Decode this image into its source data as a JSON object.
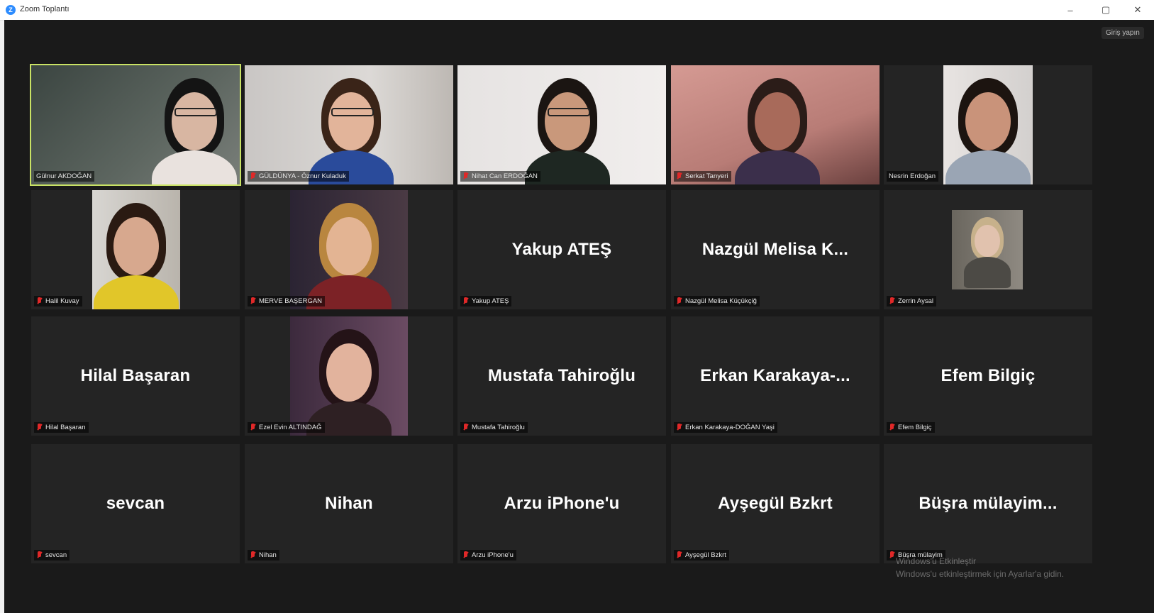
{
  "window": {
    "title": "Zoom Toplantı",
    "icon": "zoom-logo-icon",
    "minimize": "–",
    "maximize": "▢",
    "close": "✕"
  },
  "header": {
    "signin_label": "Giriş yapın"
  },
  "colors": {
    "active_speaker": "#c9e264",
    "muted_mic": "#e02828",
    "tile_bg": "#242424"
  },
  "participants": [
    {
      "label": "Gülnur AKDOĞAN",
      "display": "",
      "video": true,
      "active": true,
      "muted": false
    },
    {
      "label": "GÜLDÜNYA - Öznur Kuladuk",
      "display": "",
      "video": true,
      "muted": true
    },
    {
      "label": "Nihat Can ERDOĞAN",
      "display": "",
      "video": true,
      "muted": true
    },
    {
      "label": "Serkat Tanyeri",
      "display": "",
      "video": true,
      "muted": true
    },
    {
      "label": "Nesrin Erdoğan",
      "display": "",
      "video": true,
      "muted": false
    },
    {
      "label": "Halil Kuvay",
      "display": "",
      "video": true,
      "muted": true
    },
    {
      "label": "MERVE BAŞERGAN",
      "display": "",
      "video": true,
      "muted": true
    },
    {
      "label": "Yakup ATEŞ",
      "display": "Yakup ATEŞ",
      "video": false,
      "muted": true
    },
    {
      "label": "Nazgül Melisa Küçükçiğ",
      "display": "Nazgül  Melisa  K...",
      "video": false,
      "muted": true
    },
    {
      "label": "Zerrin Aysal",
      "display": "",
      "video": true,
      "muted": true
    },
    {
      "label": "Hilal Başaran",
      "display": "Hilal Başaran",
      "video": false,
      "muted": true
    },
    {
      "label": "Ezel Evin ALTINDAĞ",
      "display": "",
      "video": true,
      "muted": true
    },
    {
      "label": "Mustafa Tahiroğlu",
      "display": "Mustafa Tahiroğlu",
      "video": false,
      "muted": true
    },
    {
      "label": "Erkan Karakaya-DOĞAN Yaşi",
      "display": "Erkan  Karakaya-...",
      "video": false,
      "muted": true
    },
    {
      "label": "Efem Bilgiç",
      "display": "Efem Bilgiç",
      "video": false,
      "muted": true
    },
    {
      "label": "sevcan",
      "display": "sevcan",
      "video": false,
      "muted": true
    },
    {
      "label": "Nihan",
      "display": "Nihan",
      "video": false,
      "muted": true
    },
    {
      "label": "Arzu iPhone'u",
      "display": "Arzu iPhone'u",
      "video": false,
      "muted": true
    },
    {
      "label": "Ayşegül Bzkrt",
      "display": "Ayşegül Bzkrt",
      "video": false,
      "muted": true
    },
    {
      "label": "Büşra mülayim",
      "display": "Büşra  mülayim...",
      "video": false,
      "muted": true
    }
  ],
  "watermark": {
    "line1": "Windows'u Etkinleştir",
    "line2": "Windows'u etkinleştirmek için Ayarlar'a gidin."
  }
}
